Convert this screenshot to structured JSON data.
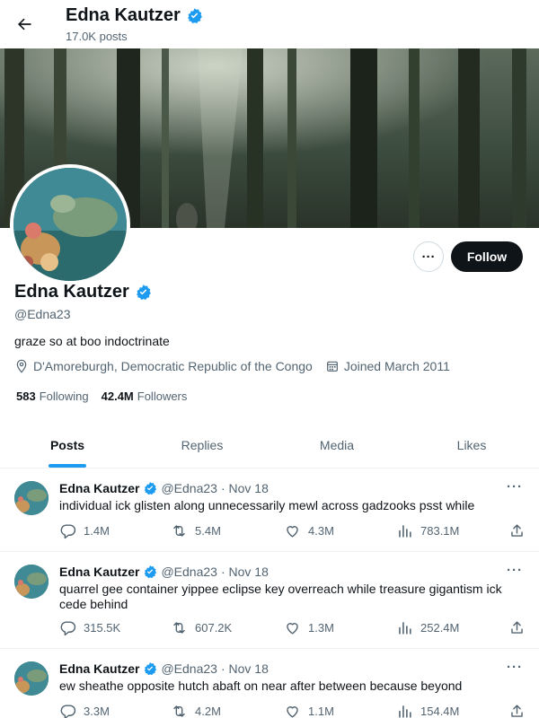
{
  "header": {
    "name": "Edna Kautzer",
    "post_count": "17.0K posts"
  },
  "profile": {
    "name": "Edna Kautzer",
    "handle": "@Edna23",
    "bio": "graze so at boo indoctrinate",
    "location": "D'Amoreburgh, Democratic Republic of the Congo",
    "joined": "Joined March 2011",
    "following_count": "583",
    "following_label": "Following",
    "followers_count": "42.4M",
    "followers_label": "Followers",
    "follow_label": "Follow",
    "more_label": "···"
  },
  "tabs": [
    {
      "label": "Posts",
      "active": true
    },
    {
      "label": "Replies",
      "active": false
    },
    {
      "label": "Media",
      "active": false
    },
    {
      "label": "Likes",
      "active": false
    }
  ],
  "posts": [
    {
      "name": "Edna Kautzer",
      "handle": "@Edna23",
      "date": "· Nov 18",
      "text": "individual ick glisten along unnecessarily mewl across gadzooks psst while",
      "replies": "1.4M",
      "reposts": "5.4M",
      "likes": "4.3M",
      "views": "783.1M"
    },
    {
      "name": "Edna Kautzer",
      "handle": "@Edna23",
      "date": "· Nov 18",
      "text": "quarrel gee container yippee eclipse key overreach while treasure gigantism ick cede behind",
      "replies": "315.5K",
      "reposts": "607.2K",
      "likes": "1.3M",
      "views": "252.4M"
    },
    {
      "name": "Edna Kautzer",
      "handle": "@Edna23",
      "date": "· Nov 18",
      "text": "ew sheathe opposite hutch abaft on near after between because beyond",
      "replies": "3.3M",
      "reposts": "4.2M",
      "likes": "1.1M",
      "views": "154.4M"
    }
  ],
  "colors": {
    "accent": "#1d9bf0",
    "text": "#0f1419",
    "muted": "#536471"
  },
  "icons": [
    "back-arrow-icon",
    "verified-badge-icon",
    "location-icon",
    "calendar-icon",
    "reply-icon",
    "repost-icon",
    "like-icon",
    "views-icon",
    "share-icon",
    "more-icon"
  ]
}
